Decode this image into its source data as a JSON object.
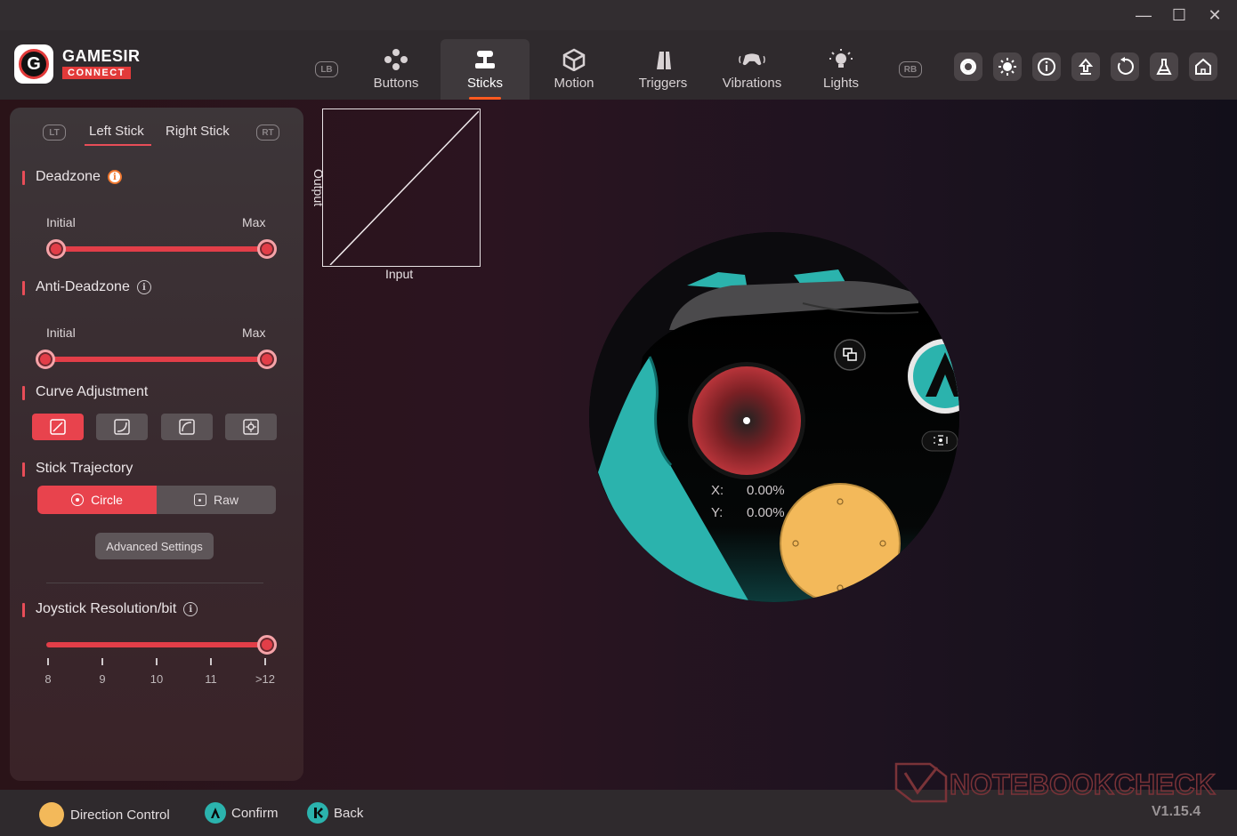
{
  "window": {
    "minimize": "—",
    "maximize": "☐",
    "close": "✕"
  },
  "logo": {
    "line1": "GAMESIR",
    "line2": "CONNECT",
    "glyph": "G"
  },
  "header": {
    "left_bumper": "LB",
    "right_bumper": "RB",
    "tabs": [
      {
        "label": "Buttons",
        "icon": "buttons-icon"
      },
      {
        "label": "Sticks",
        "icon": "sticks-icon",
        "active": true
      },
      {
        "label": "Motion",
        "icon": "motion-icon"
      },
      {
        "label": "Triggers",
        "icon": "triggers-icon"
      },
      {
        "label": "Vibrations",
        "icon": "vibrations-icon"
      },
      {
        "label": "Lights",
        "icon": "lights-icon"
      }
    ],
    "tools": [
      "record-icon",
      "brightness-icon",
      "info-icon",
      "upload-icon",
      "reset-icon",
      "lab-icon",
      "home-icon"
    ]
  },
  "panel": {
    "lt": "LT",
    "rt": "RT",
    "stick_tabs": [
      "Left Stick",
      "Right Stick"
    ],
    "deadzone": {
      "title": "Deadzone",
      "initial_label": "Initial",
      "max_label": "Max",
      "initial_value": 0.0,
      "max_value": 1.0
    },
    "anti_deadzone": {
      "title": "Anti-Deadzone",
      "initial_label": "Initial",
      "max_label": "Max",
      "initial_value": 0.0,
      "max_value": 1.0
    },
    "curve": {
      "title": "Curve Adjustment",
      "selected": 0
    },
    "trajectory": {
      "title": "Stick Trajectory",
      "options": [
        "Circle",
        "Raw"
      ],
      "selected": "Circle"
    },
    "advanced_label": "Advanced Settings",
    "resolution": {
      "title": "Joystick Resolution/bit",
      "ticks": [
        "8",
        "9",
        "10",
        "11",
        ">12"
      ],
      "value": 1.0
    }
  },
  "chart": {
    "xlabel": "Input",
    "ylabel": "Output"
  },
  "readout": {
    "x_label": "X:",
    "x_value": "0.00%",
    "y_label": "Y:",
    "y_value": "0.00%"
  },
  "footer": {
    "direction": "Direction Control",
    "confirm": "Confirm",
    "back": "Back"
  },
  "watermark": "NOTEBOOKCHECK",
  "version": "V1.15.4",
  "colors": {
    "accent": "#e23e48",
    "tab_underline": "#ff5a1f",
    "teal": "#2bb3ad",
    "yellow": "#f3b95a"
  }
}
